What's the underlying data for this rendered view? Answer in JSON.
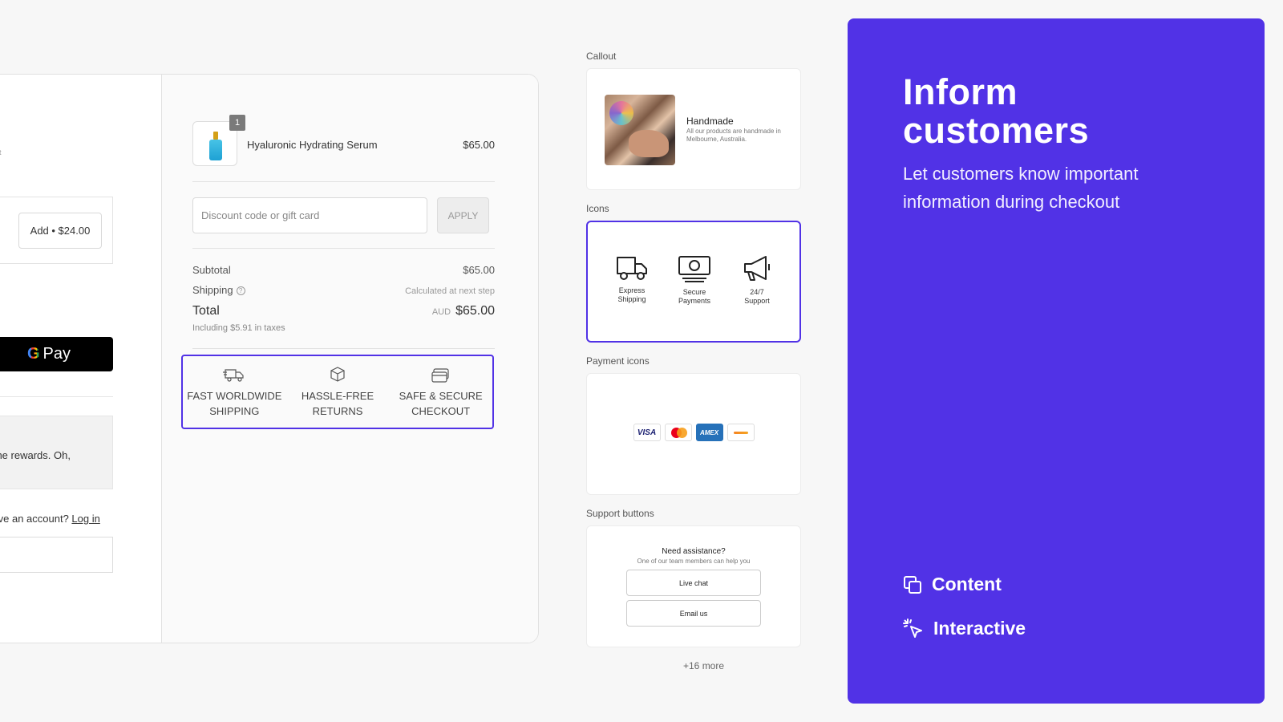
{
  "checkout": {
    "left": {
      "tiny_text": "t",
      "upsell_button": "Add • $24.00",
      "gpay_label": "Pay",
      "rewards_text": "g the rewards. Oh,",
      "account_prompt": "Have an account?",
      "login_link": "Log in"
    },
    "product": {
      "quantity": "1",
      "name": "Hyaluronic Hydrating Serum",
      "price": "$65.00"
    },
    "discount": {
      "placeholder": "Discount code or gift card",
      "apply_label": "APPLY"
    },
    "summary": {
      "subtotal_label": "Subtotal",
      "subtotal_value": "$65.00",
      "shipping_label": "Shipping",
      "shipping_value": "Calculated at next step",
      "total_label": "Total",
      "total_currency": "AUD",
      "total_value": "$65.00",
      "taxes_note": "Including $5.91 in taxes"
    },
    "badges": [
      {
        "line1": "FAST WORLDWIDE",
        "line2": "SHIPPING",
        "icon": "truck-icon"
      },
      {
        "line1": "HASSLE-FREE",
        "line2": "RETURNS",
        "icon": "box-icon"
      },
      {
        "line1": "SAFE & SECURE",
        "line2": "CHECKOUT",
        "icon": "card-icon"
      }
    ]
  },
  "blocks": {
    "callout": {
      "label": "Callout",
      "title": "Handmade",
      "text": "All our products are handmade in Melbourne, Australia."
    },
    "icons": {
      "label": "Icons",
      "items": [
        {
          "line1": "Express",
          "line2": "Shipping",
          "icon": "truck-icon"
        },
        {
          "line1": "Secure",
          "line2": "Payments",
          "icon": "money-icon"
        },
        {
          "line1": "24/7",
          "line2": "Support",
          "icon": "megaphone-icon"
        }
      ]
    },
    "payment_icons": {
      "label": "Payment icons",
      "items": [
        "VISA",
        "mastercard",
        "AMEX",
        "discover"
      ]
    },
    "support": {
      "label": "Support buttons",
      "title": "Need assistance?",
      "subtitle": "One of our team members can help you",
      "buttons": [
        "Live chat",
        "Email us"
      ]
    },
    "more": "+16 more"
  },
  "panel": {
    "title": "Inform customers",
    "subtitle": "Let customers know important information during checkout",
    "features": [
      {
        "label": "Content",
        "icon": "copy-icon"
      },
      {
        "label": "Interactive",
        "icon": "cursor-click-icon"
      }
    ],
    "color": "#5132e6"
  }
}
